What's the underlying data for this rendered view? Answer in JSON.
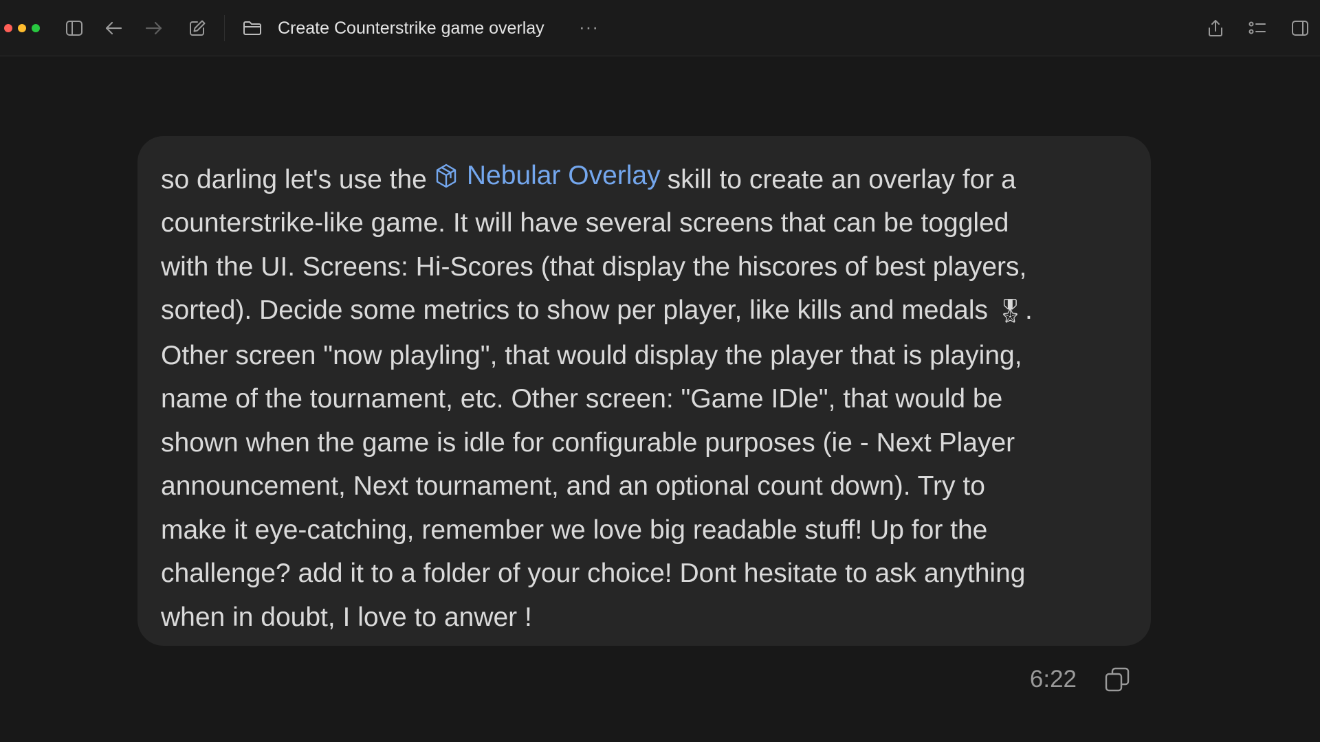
{
  "window": {
    "title": "Create Counterstrike game overlay",
    "more_label": "···",
    "traffic_colors": [
      "#ff5f57",
      "#febc2e",
      "#28c840"
    ]
  },
  "toolbar": {
    "icons": [
      "sidebar-toggle-icon",
      "back-arrow-icon",
      "forward-arrow-icon",
      "new-chat-icon",
      "folder-icon"
    ],
    "right_icons": [
      "share-icon",
      "list-icon",
      "right-panel-icon"
    ]
  },
  "message": {
    "text_before": "so darling let's use the",
    "skill_name": "Nebular Overlay",
    "skill_icon": "cube-icon",
    "text_line1_after": "skill to create an overlay for a",
    "text_lines_mid": "counterstrike-like game. It will have several screens that can be toggled\nwith the UI. Screens: Hi-Scores (that display the hiscores of best players,\nsorted). Decide some metrics to show per player, like kills and medals",
    "medal_emoji": "🎖",
    "text_after_medal": ".\nOther screen \"now playling\", that would display the player that is playing,\nname of the tournament, etc. Other screen: \"Game IDle\", that would be\nshown when the game is idle for configurable purposes (ie - Next Player\nannouncement, Next tournament, and an optional count down). Try to\nmake it eye-catching, remember we love big readable stuff! Up for the\nchallenge? add it to a folder of your choice! Dont hesitate to ask anything\nwhen in doubt, I love to anwer !",
    "timestamp": "6:22"
  },
  "colors": {
    "background": "#181818",
    "bubble": "#262626",
    "skill_accent": "#74a7ee"
  }
}
